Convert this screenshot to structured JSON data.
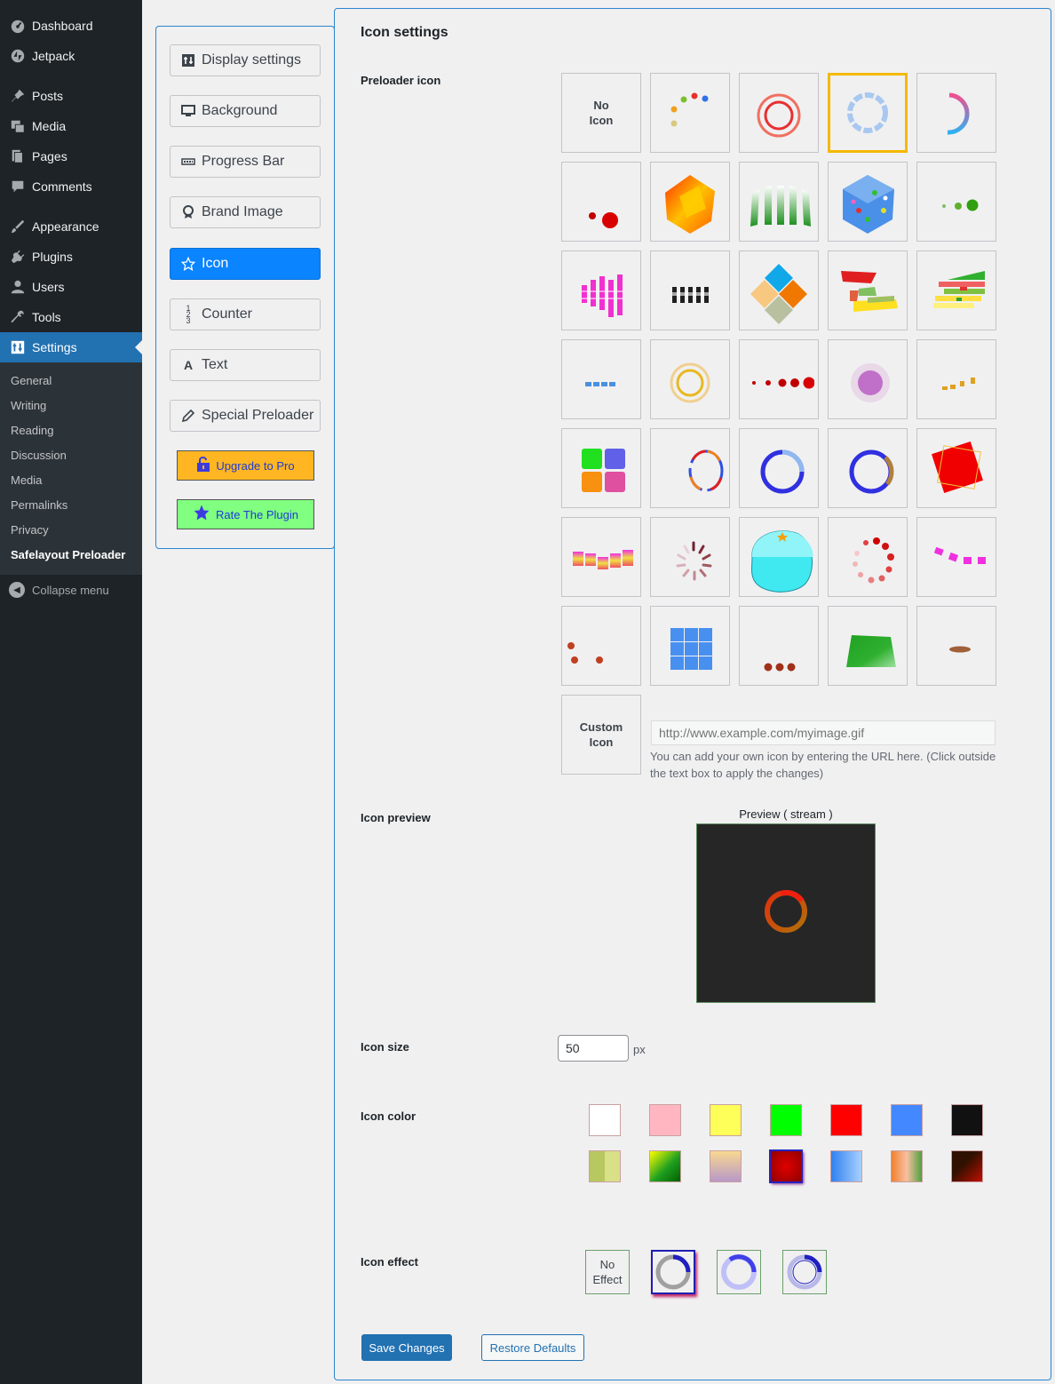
{
  "sidebar": {
    "top": [
      {
        "label": "Dashboard",
        "icon": "dashboard-icon"
      },
      {
        "label": "Jetpack",
        "icon": "jetpack-icon"
      }
    ],
    "middle": [
      {
        "label": "Posts",
        "icon": "pin-icon"
      },
      {
        "label": "Media",
        "icon": "media-icon"
      },
      {
        "label": "Pages",
        "icon": "pages-icon"
      },
      {
        "label": "Comments",
        "icon": "comments-icon"
      }
    ],
    "lower": [
      {
        "label": "Appearance",
        "icon": "brush-icon"
      },
      {
        "label": "Plugins",
        "icon": "plugin-icon"
      },
      {
        "label": "Users",
        "icon": "users-icon"
      },
      {
        "label": "Tools",
        "icon": "wrench-icon"
      },
      {
        "label": "Settings",
        "icon": "settings-icon"
      }
    ],
    "submenu": [
      "General",
      "Writing",
      "Reading",
      "Discussion",
      "Media",
      "Permalinks",
      "Privacy",
      "Safelayout Preloader"
    ],
    "collapse": "Collapse menu"
  },
  "plugin_nav": {
    "items": [
      {
        "label": "Display settings",
        "icon": "display-icon"
      },
      {
        "label": "Background",
        "icon": "monitor-icon"
      },
      {
        "label": "Progress Bar",
        "icon": "progress-icon"
      },
      {
        "label": "Brand Image",
        "icon": "award-icon"
      },
      {
        "label": "Icon",
        "icon": "star-icon"
      },
      {
        "label": "Counter",
        "icon": "counter-icon"
      },
      {
        "label": "Text",
        "icon": "text-icon"
      },
      {
        "label": "Special Preloader",
        "icon": "pencil-icon"
      }
    ],
    "upgrade": "Upgrade to Pro",
    "rate": "Rate The Plugin",
    "colors": {
      "upgrade": "#ffb622",
      "rate": "#80ff80",
      "active": "#0a84ff"
    }
  },
  "panel": {
    "title": "Icon settings",
    "preloader_label": "Preloader icon",
    "no_icon": "No\nIcon",
    "custom_icon": "Custom\nIcon",
    "url_placeholder": "http://www.example.com/myimage.gif",
    "url_help": "You can add your own icon by entering the URL here. (Click outside the text box to apply the changes)",
    "preview_label": "Icon preview",
    "preview_caption": "Preview ( stream )",
    "size_label": "Icon size",
    "size_value": "50",
    "size_unit": "px",
    "color_label": "Icon color",
    "effect_label": "Icon effect",
    "no_effect": "No\nEffect",
    "save": "Save Changes",
    "restore": "Restore Defaults"
  },
  "icon_colors": {
    "solid": [
      "#ffffff",
      "#ffb6c1",
      "#ffff5a",
      "#00ff00",
      "#ff0000",
      "#4488ff",
      "#111111"
    ],
    "gradient": [
      "gradient-olive",
      "gradient-green-yellow",
      "gradient-peach-purple",
      "gradient-red-dark",
      "gradient-blue",
      "gradient-orange-green",
      "gradient-black-red"
    ],
    "selected": "gradient-red-dark"
  }
}
